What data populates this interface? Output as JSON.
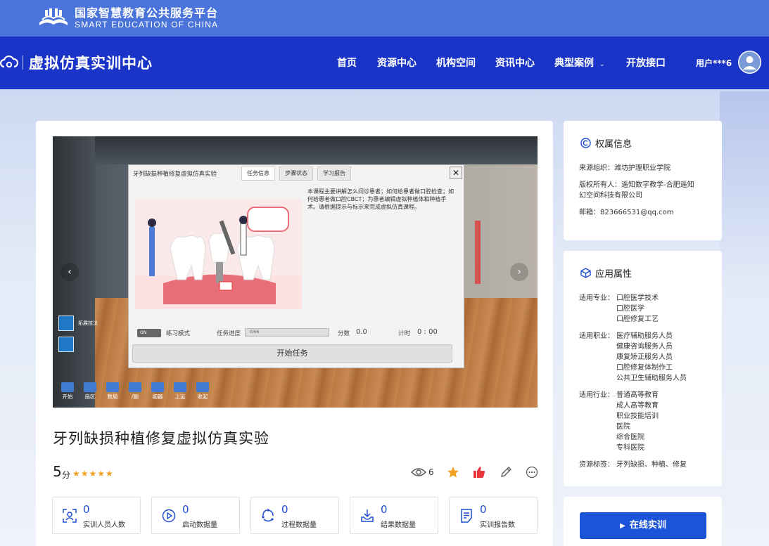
{
  "platform": {
    "name_cn": "国家智慧教育公共服务平台",
    "name_en": "SMART EDUCATION OF CHINA"
  },
  "site": {
    "title": "虚拟仿真实训中心"
  },
  "nav": {
    "items": [
      {
        "label": "首页"
      },
      {
        "label": "资源中心"
      },
      {
        "label": "机构空间"
      },
      {
        "label": "资讯中心"
      },
      {
        "label": "典型案例"
      },
      {
        "label": "开放接口"
      }
    ],
    "caret": "⌄",
    "user": "用户***6"
  },
  "viewer": {
    "prev": "‹",
    "next": "›",
    "dialog": {
      "title": "牙列缺损种植修复虚拟仿真实验",
      "tabs": [
        "任务信息",
        "步骤状态",
        "学习报告"
      ],
      "close": "✕",
      "description": "本课程主要讲解怎么问诊患者；如何给患者做口腔检查；如何给患者做口腔CBCT；为患者编辑虚拟种植体和种植手术。请根据提示与标示来完成虚拟仿真课程。",
      "toggle": "ON",
      "practice_mode": "练习模式",
      "progress_label": "任务进度",
      "progress_value": "0/66",
      "score_label": "分数",
      "score_value": "0.0",
      "timer_label": "计时",
      "timer_value": "0 : 00",
      "start_button": "开始任务"
    },
    "side_tool_label": "拓展技法",
    "toolbar": [
      "开始",
      "扇区",
      "数局",
      "/副",
      "细器",
      "上运",
      "收起"
    ]
  },
  "resource": {
    "title": "牙列缺损种植修复虚拟仿真实验",
    "score": "5",
    "score_unit": "分",
    "stars": "★★★★★",
    "views": "6"
  },
  "stats": [
    {
      "value": "0",
      "label": "实训人员人数",
      "icon": "person-scan-icon"
    },
    {
      "value": "0",
      "label": "启动数据量",
      "icon": "play-circle-icon"
    },
    {
      "value": "0",
      "label": "过程数据量",
      "icon": "cycle-icon"
    },
    {
      "value": "0",
      "label": "结果数据量",
      "icon": "download-tray-icon"
    },
    {
      "value": "0",
      "label": "实训报告数",
      "icon": "report-icon"
    }
  ],
  "ownership": {
    "heading": "权属信息",
    "rows": [
      {
        "key": "来源组织：",
        "value": "潍坊护理职业学院"
      },
      {
        "key": "版权所有人：",
        "value": "遥知数字教学-合肥遥知"
      },
      {
        "key": "",
        "value": "幻空间科技有限公司"
      },
      {
        "key": "邮箱：",
        "value": "823666531@qq.com"
      }
    ]
  },
  "attributes": {
    "heading": "应用属性",
    "majors_key": "适用专业：",
    "majors": [
      "口腔医学技术",
      "口腔医学",
      "口腔修复工艺"
    ],
    "jobs_key": "适用职业：",
    "jobs": [
      "医疗辅助服务人员",
      "健康咨询服务人员",
      "康复矫正服务人员",
      "口腔修复体制作工",
      "公共卫生辅助服务人员"
    ],
    "industries_key": "适用行业：",
    "industries": [
      "普通高等教育",
      "成人高等教育",
      "职业技能培训",
      "医院",
      "综合医院",
      "专科医院"
    ],
    "tags_key": "资源标签：",
    "tags": "牙列缺损、种植、修复"
  },
  "actions": {
    "online_training": "在线实训",
    "play_glyph": "▶"
  },
  "colors": {
    "top_bar": "#4a74d9",
    "nav_bar": "#1a34c8",
    "accent": "#1c54d9",
    "star": "#f2a221",
    "like": "#e8383d"
  }
}
